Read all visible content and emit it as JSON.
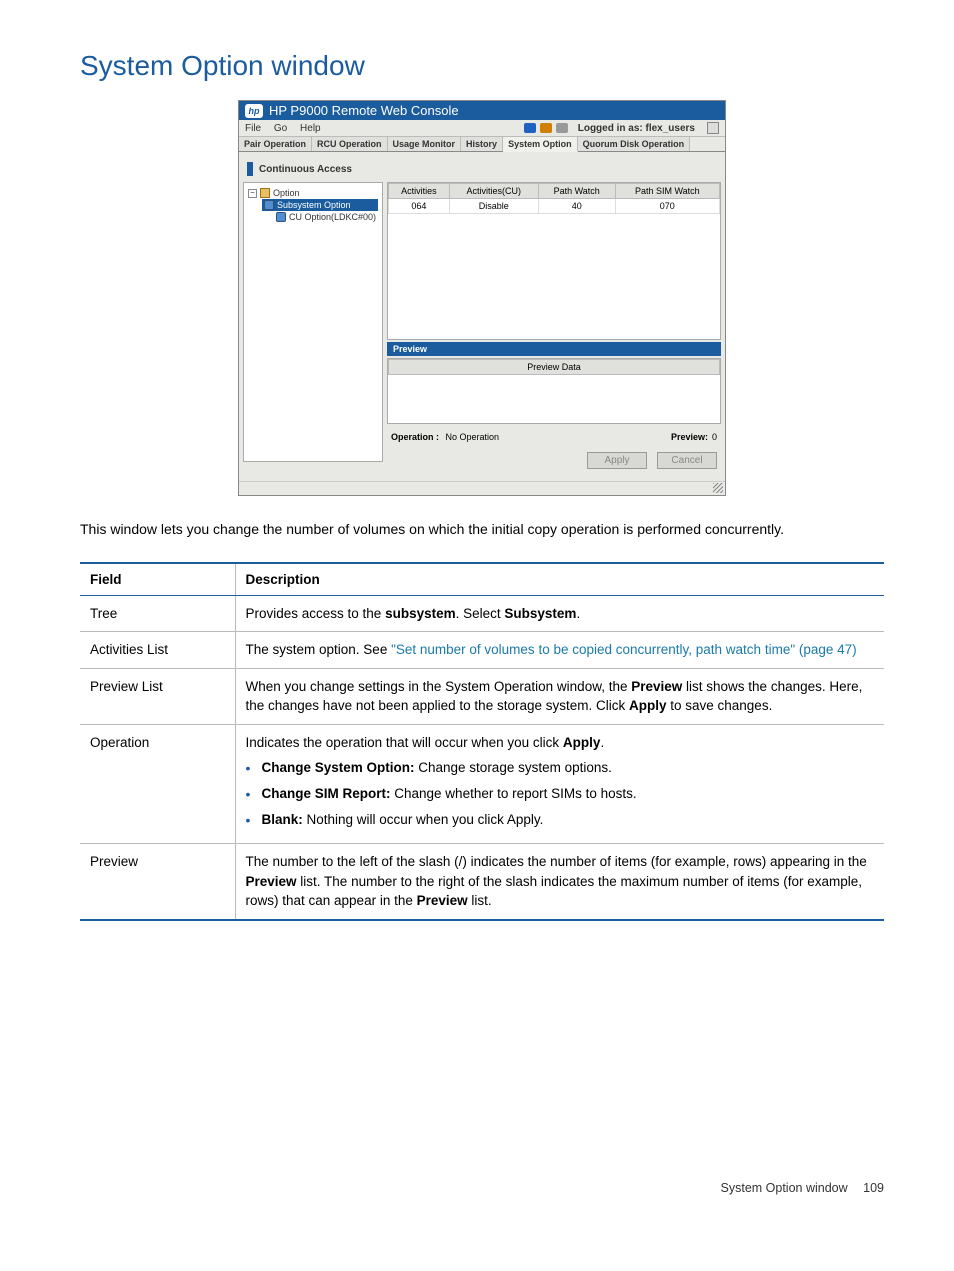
{
  "page_title": "System Option window",
  "screenshot": {
    "title": "HP P9000 Remote Web Console",
    "menu": {
      "file": "File",
      "go": "Go",
      "help": "Help"
    },
    "logged_in_as": "Logged in as: flex_users",
    "tabs": [
      "Pair Operation",
      "RCU Operation",
      "Usage Monitor",
      "History",
      "System Option",
      "Quorum Disk Operation"
    ],
    "section": "Continuous Access",
    "tree": {
      "root": "Option",
      "child1": "Subsystem Option",
      "child2": "CU Option(LDKC#00)"
    },
    "table_headers": [
      "Activities",
      "Activities(CU)",
      "Path Watch",
      "Path SIM Watch"
    ],
    "table_row": [
      "064",
      "Disable",
      "40",
      "070"
    ],
    "preview_header": "Preview",
    "preview_col": "Preview Data",
    "operation_label": "Operation :",
    "operation_value": "No Operation",
    "preview_label": "Preview:",
    "preview_value": "0",
    "apply_btn": "Apply",
    "cancel_btn": "Cancel"
  },
  "intro": "This window lets you change the number of volumes on which the initial copy operation is performed concurrently.",
  "table": {
    "h_field": "Field",
    "h_desc": "Description",
    "rows": {
      "tree": {
        "field": "Tree",
        "d1": "Provides access to the ",
        "d2": "subsystem",
        "d3": ". Select ",
        "d4": "Subsystem",
        "d5": "."
      },
      "act": {
        "field": "Activities List",
        "d1": "The system option. See ",
        "link": "\"Set number of volumes to be copied concurrently, path watch time\" (page 47)"
      },
      "prevlist": {
        "field": "Preview List",
        "d1": "When you change settings in the System Operation window, the ",
        "b1": "Preview",
        "d2": " list shows the changes. Here, the changes have not been applied to the storage system. Click ",
        "b2": "Apply",
        "d3": " to save changes."
      },
      "op": {
        "field": "Operation",
        "d1": "Indicates the operation that will occur when you click ",
        "b1": "Apply",
        "d2": ".",
        "li1b": "Change System Option:",
        "li1t": " Change storage system options.",
        "li2b": "Change SIM Report:",
        "li2t": " Change whether to report SIMs to hosts.",
        "li3b": "Blank:",
        "li3t": " Nothing will occur when you click Apply."
      },
      "prev": {
        "field": "Preview",
        "d1": "The number to the left of the slash (/) indicates the number of items (for example, rows) appearing in the ",
        "b1": "Preview",
        "d2": " list. The number to the right of the slash indicates the maximum number of items (for example, rows) that can appear in the ",
        "b2": "Preview",
        "d3": " list."
      }
    }
  },
  "footer": {
    "text": "System Option window",
    "page": "109"
  }
}
